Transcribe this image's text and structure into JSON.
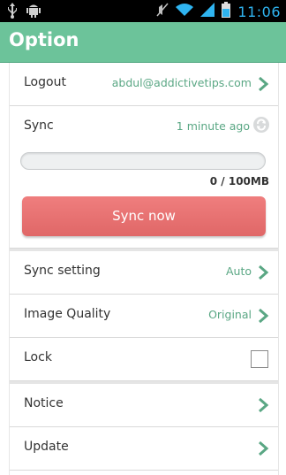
{
  "status_bar": {
    "time": "11:06",
    "icons": [
      "usb-icon",
      "android-icon",
      "mute-icon",
      "wifi-icon",
      "signal-icon",
      "battery-icon"
    ]
  },
  "action_bar": {
    "title": "Option",
    "color": "#6cc39a"
  },
  "settings": {
    "logout": {
      "label": "Logout",
      "value": "abdul@addictivetips.com"
    },
    "sync": {
      "label": "Sync",
      "value": "1 minute ago",
      "progress_text": "0 / 100MB",
      "progress_fraction": 0,
      "button_label": "Sync now",
      "button_color": "#e36a6a"
    },
    "sync_setting": {
      "label": "Sync setting",
      "value": "Auto"
    },
    "image_quality": {
      "label": "Image Quality",
      "value": "Original"
    },
    "lock": {
      "label": "Lock",
      "checked": false
    },
    "notice": {
      "label": "Notice"
    },
    "update": {
      "label": "Update"
    }
  },
  "accent_color": "#5aa784"
}
